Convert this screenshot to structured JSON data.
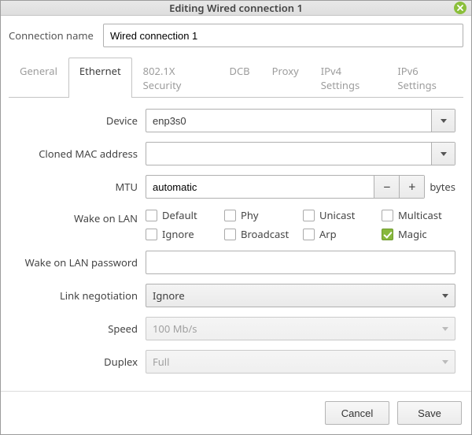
{
  "titlebar": {
    "title": "Editing Wired connection 1"
  },
  "connection": {
    "name_label": "Connection name",
    "name_value": "Wired connection 1"
  },
  "tabs": {
    "general": "General",
    "ethernet": "Ethernet",
    "security": "802.1X Security",
    "dcb": "DCB",
    "proxy": "Proxy",
    "ipv4": "IPv4 Settings",
    "ipv6": "IPv6 Settings"
  },
  "ethernet": {
    "device_label": "Device",
    "device_value": "enp3s0",
    "cloned_label": "Cloned MAC address",
    "cloned_value": "",
    "mtu_label": "MTU",
    "mtu_value": "automatic",
    "mtu_unit": "bytes",
    "wol_label": "Wake on LAN",
    "wol": {
      "default": {
        "label": "Default",
        "checked": false
      },
      "phy": {
        "label": "Phy",
        "checked": false
      },
      "unicast": {
        "label": "Unicast",
        "checked": false
      },
      "multicast": {
        "label": "Multicast",
        "checked": false
      },
      "ignore": {
        "label": "Ignore",
        "checked": false
      },
      "broadcast": {
        "label": "Broadcast",
        "checked": false
      },
      "arp": {
        "label": "Arp",
        "checked": false
      },
      "magic": {
        "label": "Magic",
        "checked": true
      }
    },
    "wol_password_label": "Wake on LAN password",
    "wol_password_value": "",
    "link_neg_label": "Link negotiation",
    "link_neg_value": "Ignore",
    "speed_label": "Speed",
    "speed_value": "100 Mb/s",
    "duplex_label": "Duplex",
    "duplex_value": "Full"
  },
  "footer": {
    "cancel": "Cancel",
    "save": "Save"
  }
}
